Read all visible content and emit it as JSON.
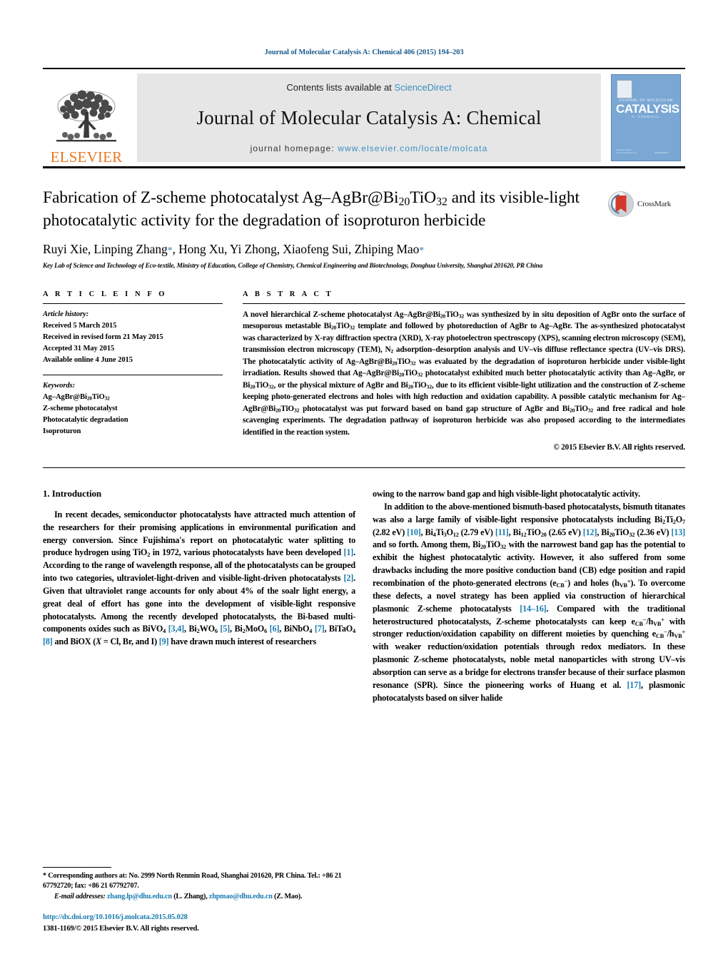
{
  "running_head": "Journal of Molecular Catalysis A: Chemical 406 (2015) 194–203",
  "masthead": {
    "publisher": "ELSEVIER",
    "contents_prefix": "Contents lists available at ",
    "contents_link": "ScienceDirect",
    "journal_name": "Journal of Molecular Catalysis A: Chemical",
    "homepage_prefix": "journal homepage: ",
    "homepage_url": "www.elsevier.com/locate/molcata",
    "cover": {
      "line_top": "JOURNAL OF MOLECULAR",
      "line_main": "CATALYSIS",
      "line_bottom": "A: CHEMICAL",
      "footer_right": "ScienceDirect",
      "footer_left": "Available online at www.sciencedirect.com"
    }
  },
  "article": {
    "title": "Fabrication of Z-scheme photocatalyst Ag–AgBr@Bi20TiO32 and its visible-light photocatalytic activity for the degradation of isoproturon herbicide",
    "crossmark_label": "CrossMark",
    "authors": "Ruyi Xie, Linping Zhang*, Hong Xu, Yi Zhong, Xiaofeng Sui, Zhiping Mao*",
    "affiliation": "Key Lab of Science and Technology of Eco-textile, Ministry of Education, College of Chemistry, Chemical Engineering and Biotechnology, Donghua University, Shanghai 201620, PR China"
  },
  "article_info": {
    "heading": "A R T I C L E   I N F O",
    "history_label": "Article history:",
    "history": [
      "Received 5 March 2015",
      "Received in revised form 21 May 2015",
      "Accepted 31 May 2015",
      "Available online 4 June 2015"
    ],
    "keywords_label": "Keywords:",
    "keywords": [
      "Ag–AgBr@Bi20TiO32",
      "Z-scheme photocatalyst",
      "Photocatalytic degradation",
      "Isoproturon"
    ]
  },
  "abstract": {
    "heading": "A B S T R A C T",
    "text": "A novel hierarchical Z-scheme photocatalyst Ag–AgBr@Bi20TiO32 was synthesized by in situ deposition of AgBr onto the surface of mesoporous metastable Bi20TiO32 template and followed by photoreduction of AgBr to Ag–AgBr. The as-synthesized photocatalyst was characterized by X-ray diffraction spectra (XRD), X-ray photoelectron spectroscopy (XPS), scanning electron microscopy (SEM), transmission electron microscopy (TEM), N2 adsorption–desorption analysis and UV–vis diffuse reflectance spectra (UV–vis DRS). The photocatalytic activity of Ag–AgBr@Bi20TiO32 was evaluated by the degradation of isoproturon herbicide under visible-light irradiation. Results showed that Ag–AgBr@Bi20TiO32 photocatalyst exhibited much better photocatalytic activity than Ag–AgBr, or Bi20TiO32, or the physical mixture of AgBr and Bi20TiO32, due to its efficient visible-light utilization and the construction of Z-scheme keeping photo-generated electrons and holes with high reduction and oxidation capability. A possible catalytic mechanism for Ag–AgBr@Bi20TiO32 photocatalyst was put forward based on band gap structure of AgBr and Bi20TiO32 and free radical and hole scavenging experiments. The degradation pathway of isoproturon herbicide was also proposed according to the intermediates identified in the reaction system.",
    "copyright": "© 2015 Elsevier B.V. All rights reserved."
  },
  "body": {
    "section_number_title": "1.  Introduction",
    "left_paragraph_1": "In recent decades, semiconductor photocatalysts have attracted much attention of the researchers for their promising applications in environmental purification and energy conversion. Since Fujishima's report on photocatalytic water splitting to produce hydrogen using TiO2 in 1972, various photocatalysts have been developed [1]. According to the range of wavelength response, all of the photocatalysts can be grouped into two categories, ultraviolet-light-driven and visible-light-driven photocatalysts [2]. Given that ultraviolet range accounts for only about 4% of the soalr light energy, a great deal of effort has gone into the development of visible-light responsive photocatalysts. Among the recently developed photocatalysts, the Bi-based multi-components oxides such as BiVO4 [3,4], Bi2WO6 [5], Bi2MoO6 [6], BiNbO4 [7], BiTaO4 [8] and BiOX (X = Cl, Br, and I) [9] have drawn much interest of researchers",
    "right_paragraph_continued": "owing to the narrow band gap and high visible-light photocatalytic activity.",
    "right_paragraph_2": "In addition to the above-mentioned bismuth-based photocatalysts, bismuth titanates was also a large family of visible-light responsive photocatalysts including Bi2Ti2O7 (2.82 eV) [10], Bi4Ti3O12 (2.79 eV) [11], Bi12TiO20 (2.65 eV) [12], Bi20TiO32 (2.36 eV) [13] and so forth. Among them, Bi20TiO32 with the narrowest band gap has the potential to exhibit the highest photocatalytic activity. However, it also suffered from some drawbacks including the more positive conduction band (CB) edge position and rapid recombination of the photo-generated electrons (eCB−) and holes (hVB+). To overcome these defects, a novel strategy has been applied via construction of hierarchical plasmonic Z-scheme photocatalysts [14–16]. Compared with the traditional heterostructured photocatalysts, Z-scheme photocatalysts can keep eCB−/hVB+ with stronger reduction/oxidation capability on different moieties by quenching eCB−/hVB+ with weaker reduction/oxidation potentials through redox mediators. In these plasmonic Z-scheme photocatalysts, noble metal nanoparticles with strong UV–vis absorption can serve as a bridge for electrons transfer because of their surface plasmon resonance (SPR). Since the pioneering works of Huang et al. [17], plasmonic photocatalysts based on silver halide"
  },
  "footnote": {
    "corresponding": "* Corresponding authors at: No. 2999 North Renmin Road, Shanghai 201620, PR China. Tel.: +86 21 67792720; fax: +86 21 67792707.",
    "email_label": "E-mail addresses:",
    "email_1": "zhang.lp@dhu.edu.cn",
    "email_1_owner": "(L. Zhang),",
    "email_2": "zhpmao@dhu.edu.cn",
    "email_2_owner": "(Z. Mao)."
  },
  "doi_block": {
    "doi_url": "http://dx.doi.org/10.1016/j.molcata.2015.05.028",
    "issn_line": "1381-1169/© 2015 Elsevier B.V. All rights reserved."
  },
  "colors": {
    "link": "#1a7cb0",
    "running_head": "#1a5c8f",
    "elsevier_orange": "#E87722",
    "sciencedirect": "#3a8fc0",
    "cover_blue": "#7aa7d4",
    "crossmark_red": "#d2392c"
  }
}
